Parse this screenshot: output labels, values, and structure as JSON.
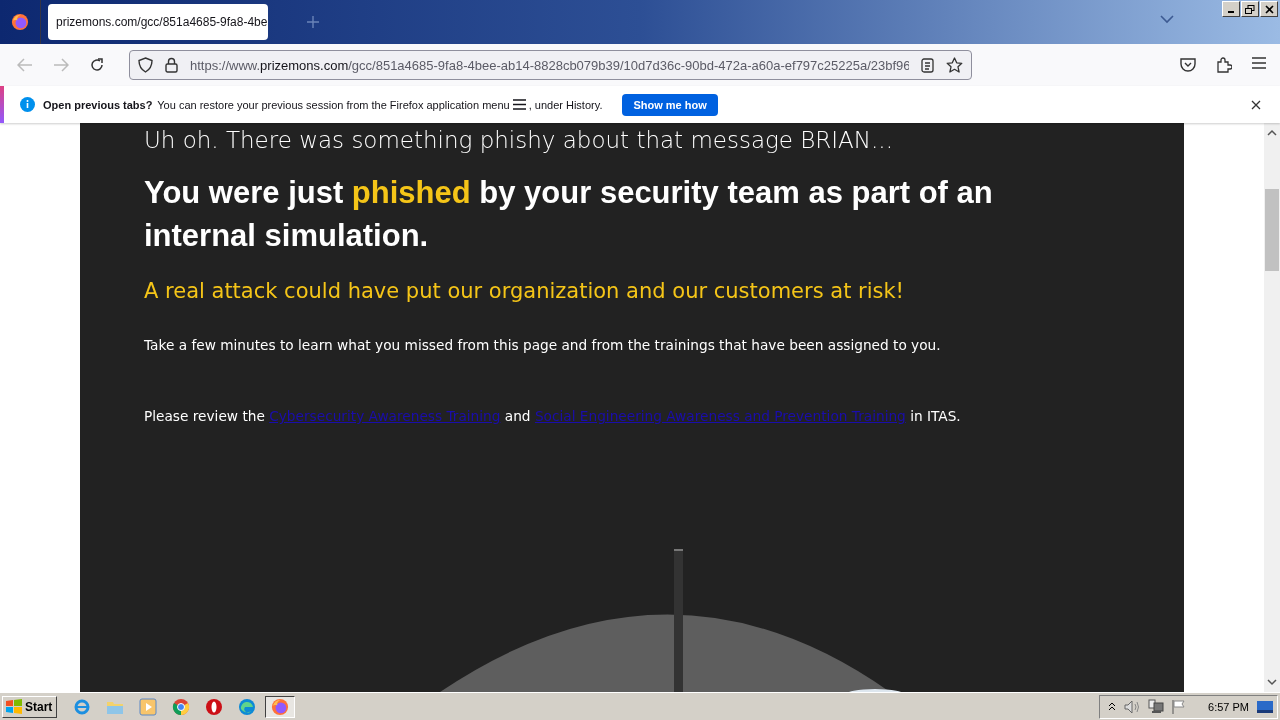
{
  "browser": {
    "tabs": [
      {
        "label": "prizemons.com/gcc/851a4685-9fa8-4be",
        "selected": true
      }
    ],
    "address": {
      "scheme": "https://www.",
      "host": "prizemons.com",
      "path": "/gcc/851a4685-9fa8-4bee-ab14-8828cb079b39/10d7d36c-90bd-472a-a60a-ef797c25225a/23bf96"
    }
  },
  "notification": {
    "title": "Open previous tabs?",
    "text_before": "You can restore your previous session from the Firefox application menu",
    "text_after": ", under History.",
    "button": "Show me how"
  },
  "page": {
    "intro": "Uh oh. There was something phishy about that message BRIAN...",
    "heading": "You were just **phished** by your security team as part of an internal simulation.",
    "warning": "A real attack could have put our organization and our customers at risk!",
    "instruction": "Take a few minutes to learn what you missed from this page and from the trainings that have been assigned to you.",
    "review": [
      {
        "kind": "text",
        "text": "Please review the "
      },
      {
        "kind": "link",
        "text": "Cybersecurity Awareness Training"
      },
      {
        "kind": "text",
        "text": " and "
      },
      {
        "kind": "link",
        "text": "Social Engineering Awareness and Prevention Training"
      },
      {
        "kind": "text",
        "text": " in ITAS."
      }
    ]
  },
  "taskbar": {
    "start": "Start",
    "apps": [
      {
        "kind": "ie",
        "selected": false
      },
      {
        "kind": "folder",
        "selected": false
      },
      {
        "kind": "media",
        "selected": false
      },
      {
        "kind": "chrome",
        "selected": false
      },
      {
        "kind": "opera",
        "selected": false
      },
      {
        "kind": "edge",
        "selected": false
      },
      {
        "kind": "firefox",
        "selected": true
      }
    ],
    "clock": "6:57 PM"
  }
}
